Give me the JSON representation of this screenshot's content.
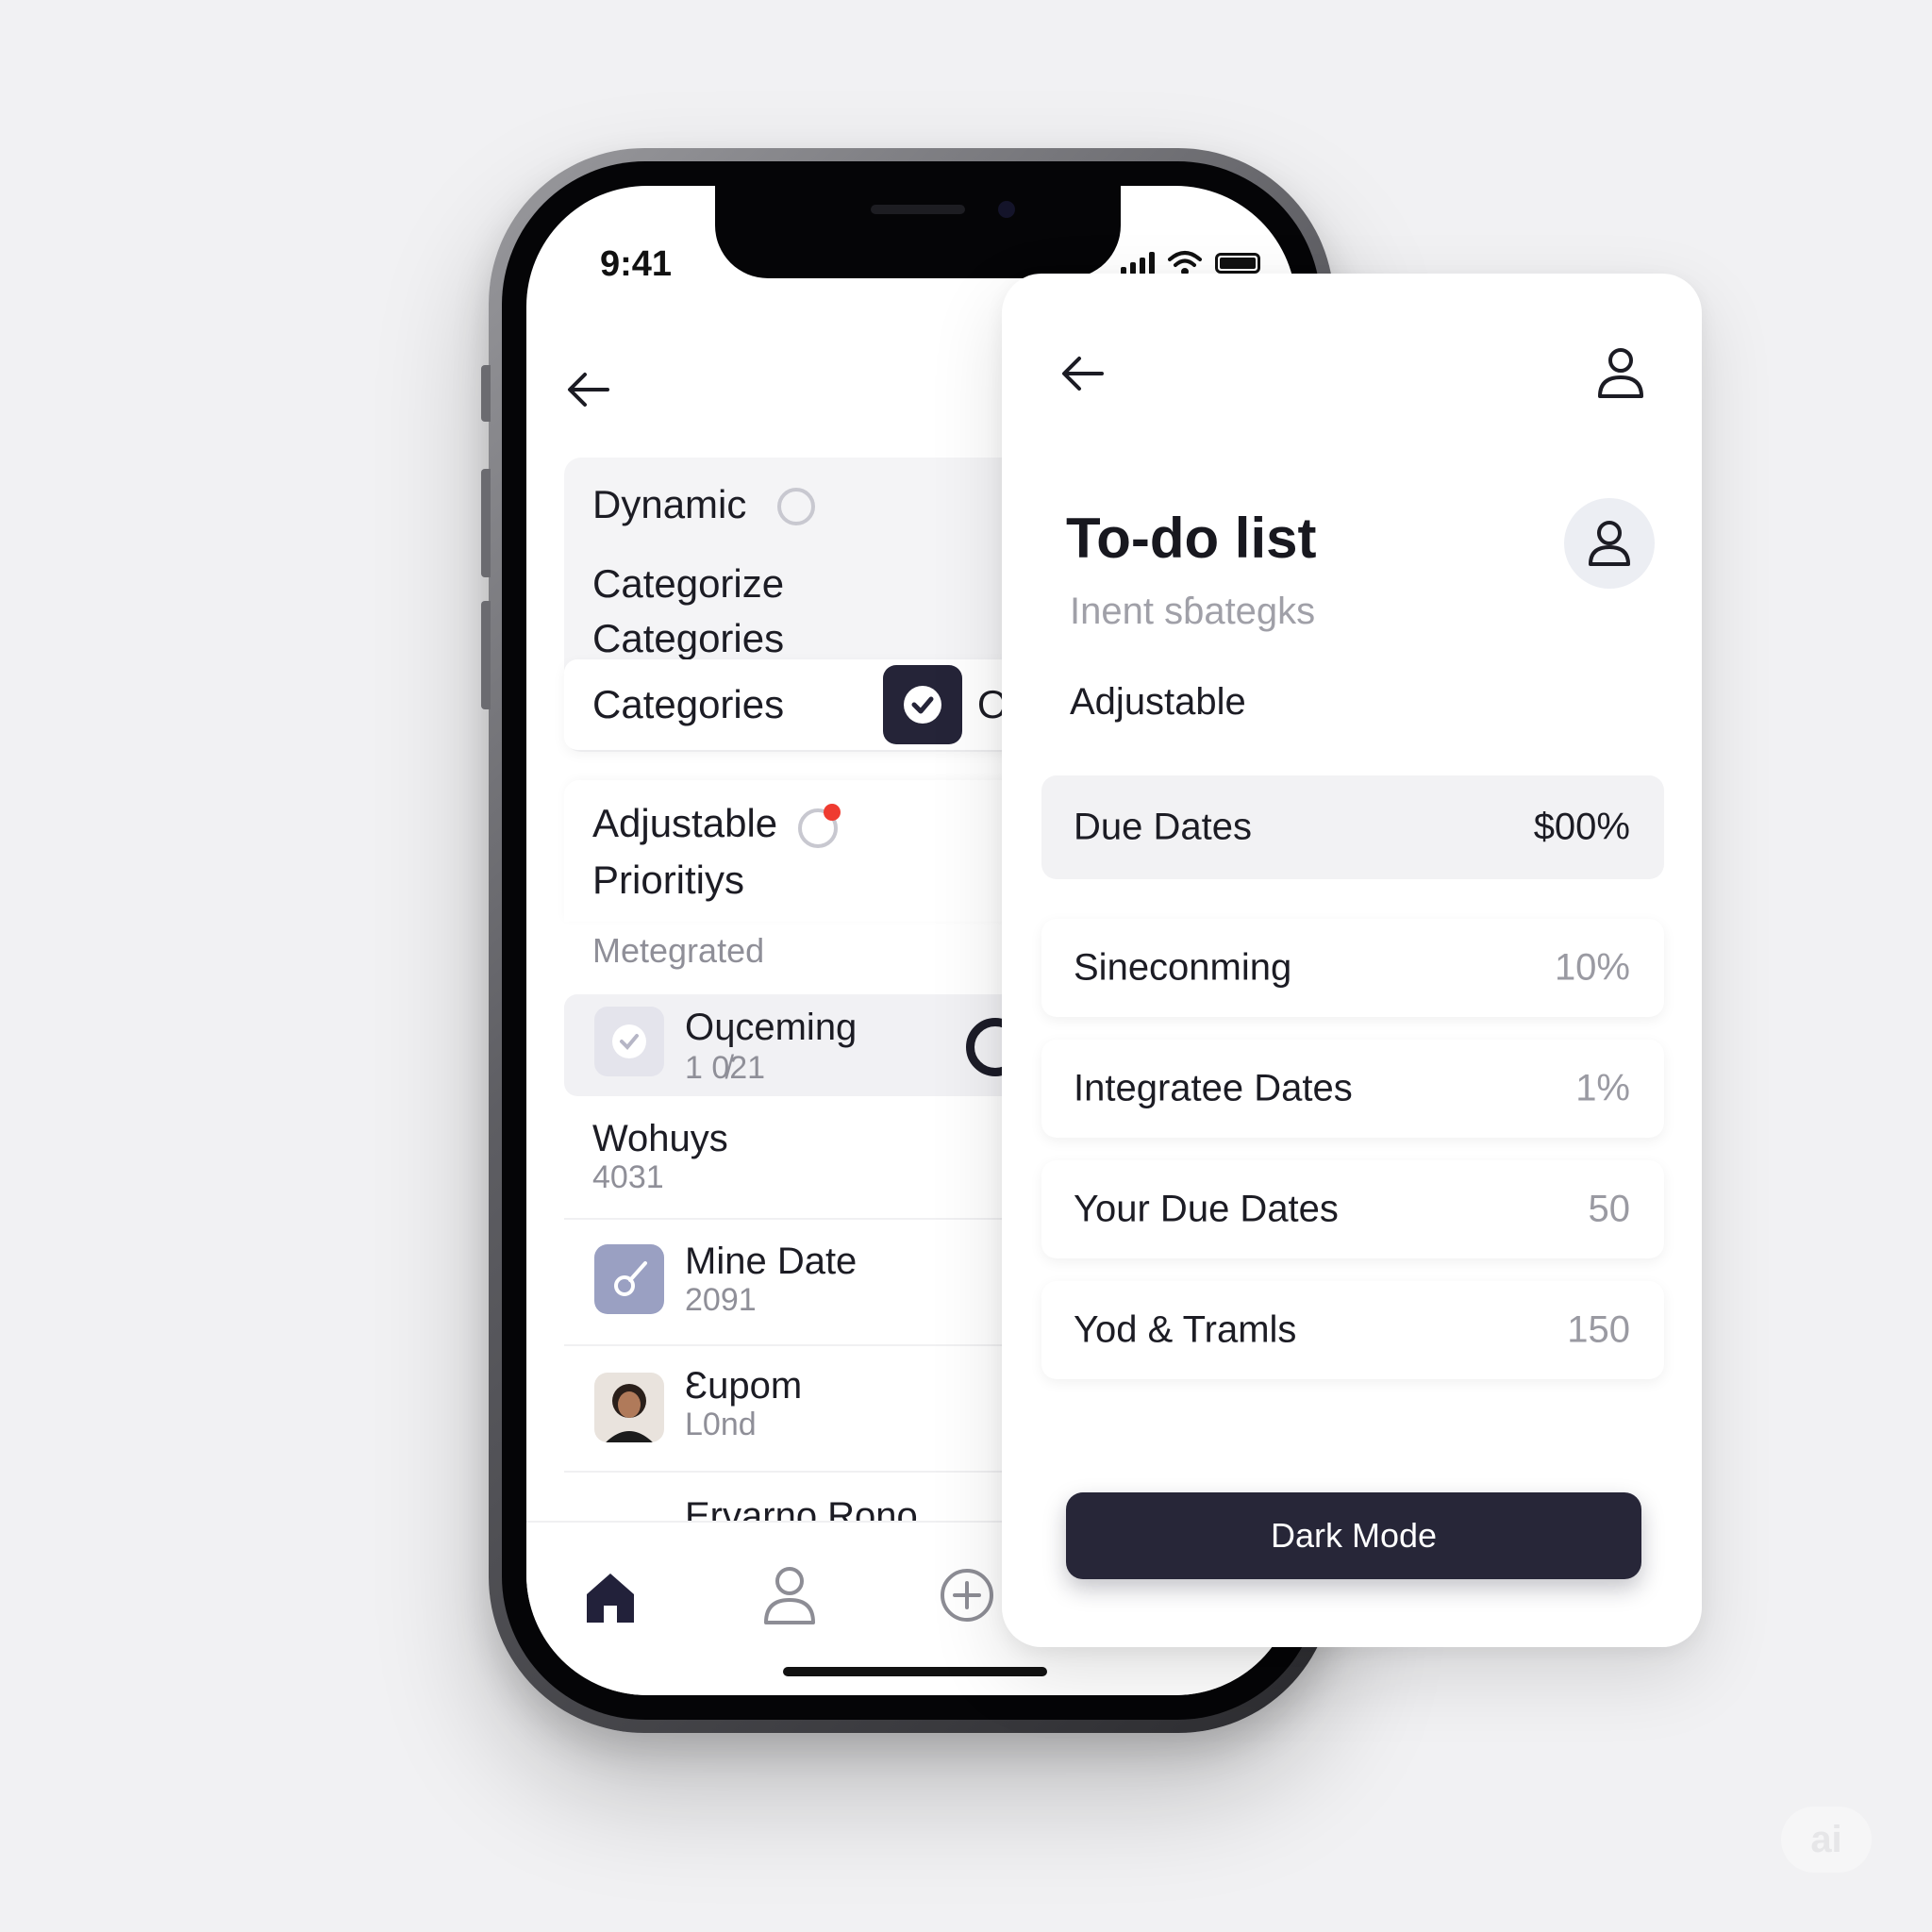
{
  "status_bar": {
    "time": "9:41"
  },
  "left_screen": {
    "card1": {
      "title": "Dynamic",
      "line1": "Categorize",
      "line2": "Categories",
      "row_label": "Categories",
      "row_trailing": "O"
    },
    "card2": {
      "title": "Adjustable",
      "line2": "Prioritiys",
      "section": "Metegrated"
    },
    "items": [
      {
        "title": "Oɥceming",
        "sub": "1 0̸21"
      },
      {
        "title": "Wohuys",
        "sub": "4031"
      },
      {
        "title": "Mine Date",
        "sub": "2091"
      },
      {
        "title": "Ɛupom",
        "sub": "L0nd"
      },
      {
        "title": "Ervarno Rono",
        "sub": ""
      }
    ]
  },
  "overlay": {
    "title": "To-do list",
    "subtitle": "Inent sɓategks",
    "section": "Adjustable",
    "rows": [
      {
        "label": "Due Dates",
        "value": "$00%"
      },
      {
        "label": "Sineconming",
        "value": "10%"
      },
      {
        "label": "Integratee Dates",
        "value": "1%"
      },
      {
        "label": "Your Due Dates",
        "value": "50"
      },
      {
        "label": "Yod & Tramls",
        "value": "150"
      }
    ],
    "button": "Dark Mode"
  },
  "watermark": "ai",
  "colors": {
    "accent_dark": "#272638",
    "notification_red": "#ef3b30",
    "background": "#f1f1f3"
  }
}
